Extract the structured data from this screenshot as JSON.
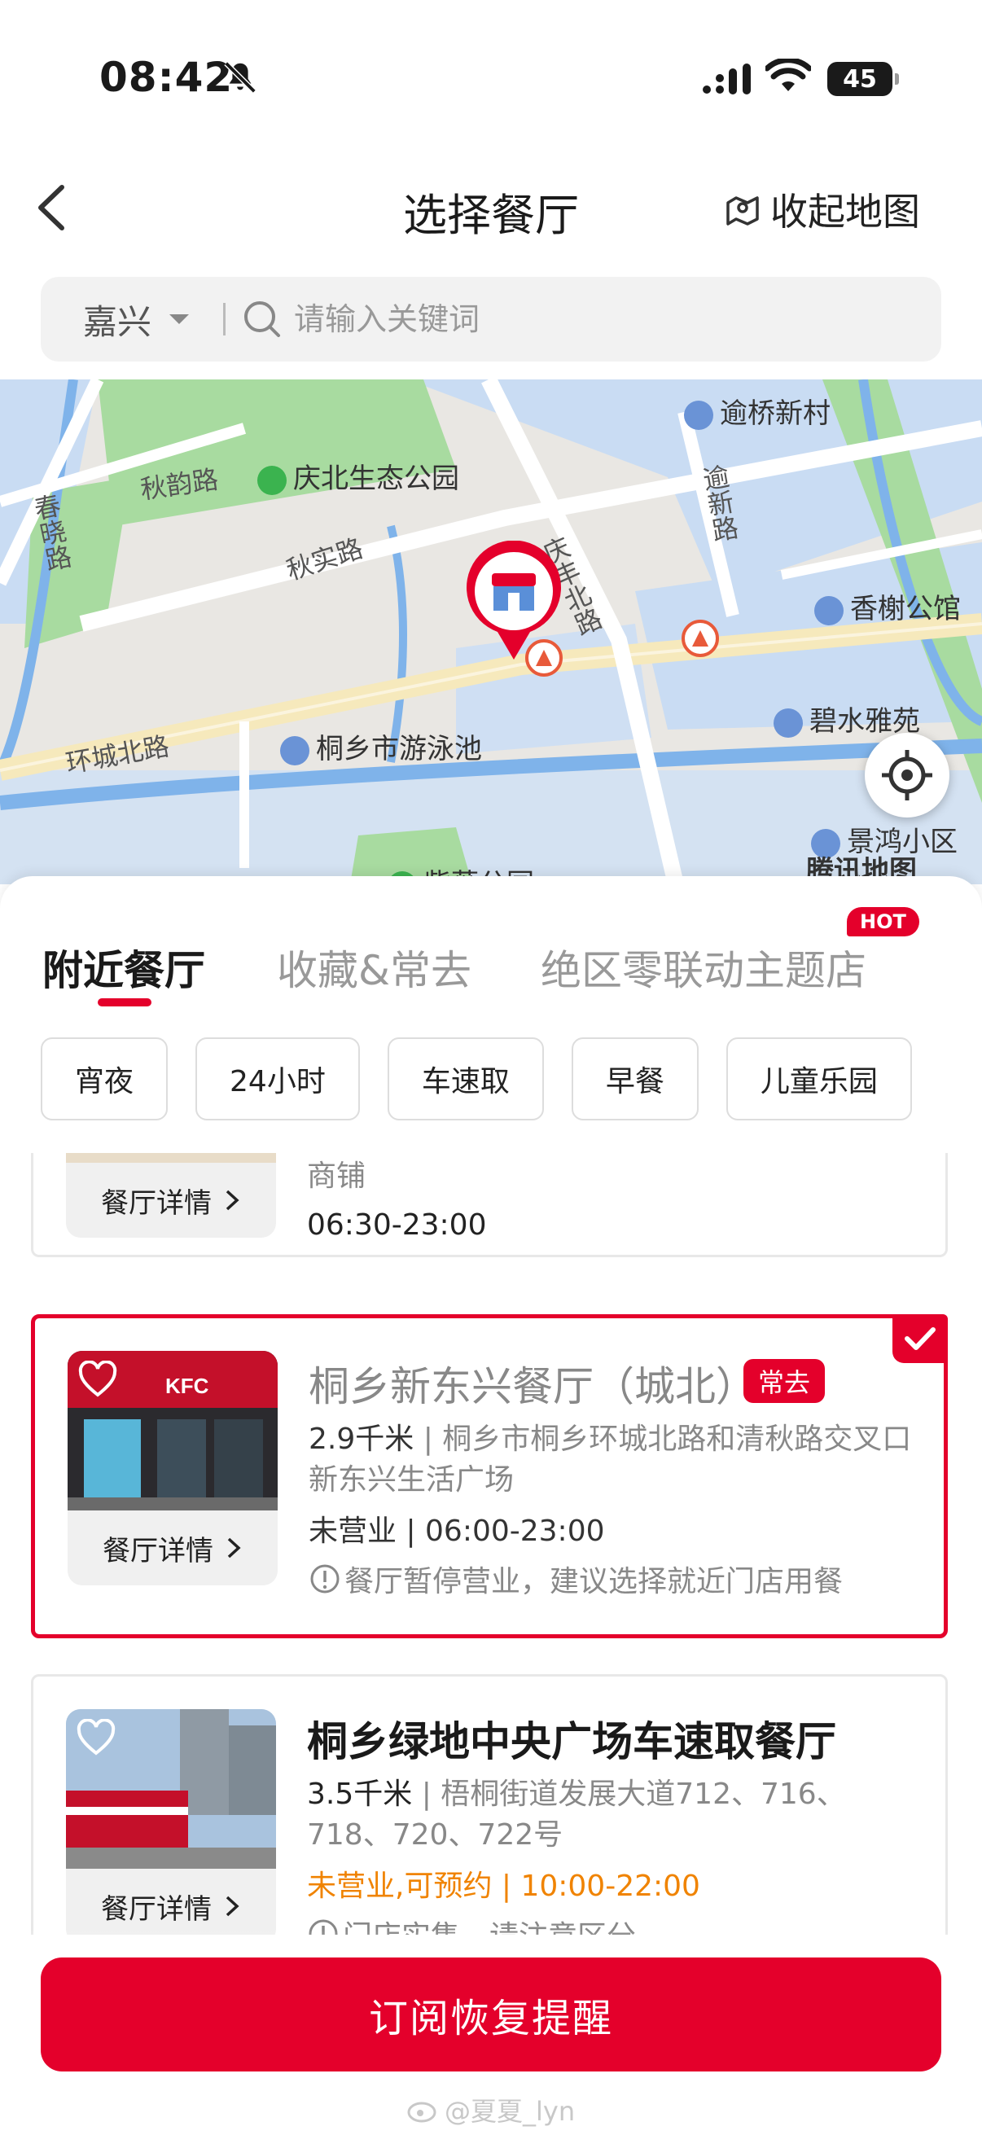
{
  "status_bar": {
    "time": "08:42",
    "battery": "45"
  },
  "header": {
    "title": "选择餐厅",
    "collapse_map": "收起地图"
  },
  "search": {
    "city": "嘉兴",
    "placeholder": "请输入关键词"
  },
  "map": {
    "labels": {
      "yuqiao": "逾桥新村",
      "qingbei_park": "庆北生态公园",
      "qiuyun_road": "秋韵路",
      "chunxiao_road": "春晓路",
      "qiushi_road": "秋实路",
      "qingfeng_north": "庆丰北路",
      "yuxin_road": "逾新路",
      "xiangxie": "香榭公馆",
      "bishui": "碧水雅苑",
      "huancheng_north": "环城北路",
      "swimming_pool": "桐乡市游泳池",
      "jinghong": "景鸿小区",
      "ziwei_park": "紫薇公园",
      "tencent": "腾讯地图"
    }
  },
  "tabs": [
    {
      "label": "附近餐厅"
    },
    {
      "label": "收藏&常去"
    },
    {
      "label": "绝区零联动主题店"
    }
  ],
  "hot_badge": "HOT",
  "filters": [
    "宵夜",
    "24小时",
    "车速取",
    "早餐",
    "儿童乐园"
  ],
  "stores": [
    {
      "addr_tail": "商铺",
      "hours": "06:30-23:00",
      "detail": "餐厅详情"
    },
    {
      "name": "桐乡新东兴餐厅（城北）",
      "tag": "常去",
      "distance": "2.9千米",
      "address": "桐乡市桐乡环城北路和清秋路交叉口新东兴生活广场",
      "hours": "未营业 | 06:00-23:00",
      "notice": "餐厅暂停营业，建议选择就近门店用餐",
      "detail": "餐厅详情",
      "thumb_sign": "KFC"
    },
    {
      "name": "桐乡绿地中央广场车速取餐厅",
      "distance": "3.5千米",
      "address": "梧桐街道发展大道712、716、718、720、722号",
      "hours": "未营业,可预约 | 10:00-22:00",
      "notice": "门店实售，请注意区分",
      "detail": "餐厅详情"
    }
  ],
  "cta": "订阅恢复提醒",
  "watermark": "@夏夏_lyn",
  "colors": {
    "brand_red": "#e4002b",
    "orange": "#f08300"
  }
}
